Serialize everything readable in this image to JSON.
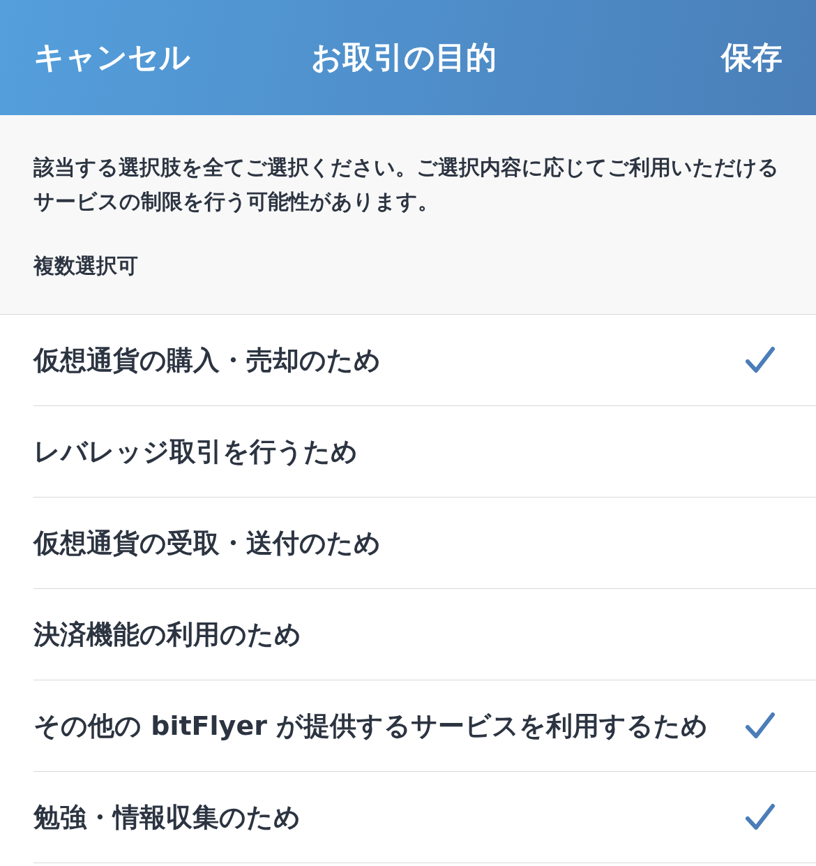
{
  "header": {
    "cancel": "キャンセル",
    "title": "お取引の目的",
    "save": "保存"
  },
  "info": {
    "description": "該当する選択肢を全てご選択ください。ご選択内容に応じてご利用いただけるサービスの制限を行う可能性があります。",
    "note": "複数選択可"
  },
  "options": [
    {
      "label": "仮想通貨の購入・売却のため",
      "checked": true
    },
    {
      "label": "レバレッジ取引を行うため",
      "checked": false
    },
    {
      "label": "仮想通貨の受取・送付のため",
      "checked": false
    },
    {
      "label": "決済機能の利用のため",
      "checked": false
    },
    {
      "label": "その他の bitFlyer が提供するサービスを利用するため",
      "checked": true
    },
    {
      "label": "勉強・情報収集のため",
      "checked": true
    }
  ]
}
